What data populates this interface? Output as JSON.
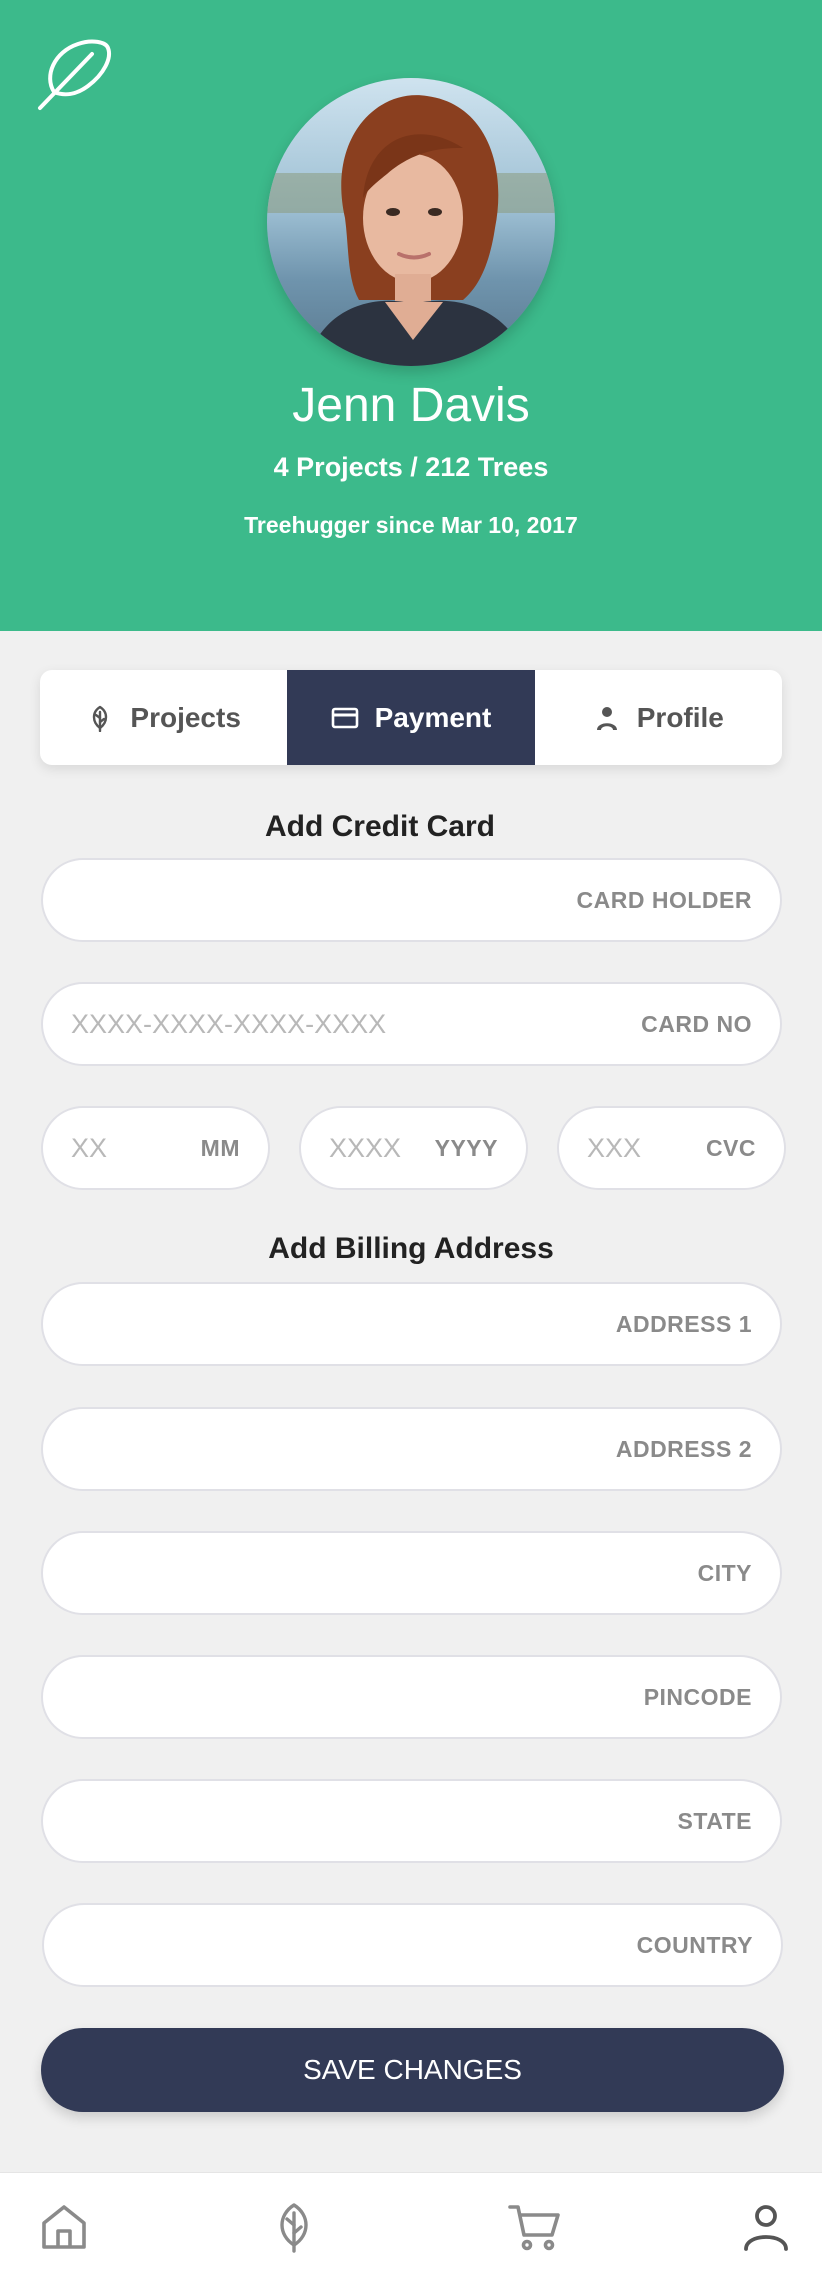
{
  "profile": {
    "name": "Jenn Davis",
    "stats": "4 Projects / 212 Trees",
    "since": "Treehugger since Mar 10, 2017"
  },
  "tabs": [
    {
      "label": "Projects",
      "icon": "leaf-icon"
    },
    {
      "label": "Payment",
      "icon": "credit-card-icon",
      "active": true
    },
    {
      "label": "Profile",
      "icon": "person-icon"
    }
  ],
  "credit_card": {
    "title": "Add Credit Card",
    "card_holder": {
      "label": "CARD HOLDER",
      "placeholder": ""
    },
    "card_no": {
      "label": "CARD NO",
      "placeholder": "XXXX-XXXX-XXXX-XXXX"
    },
    "month": {
      "label": "MM",
      "placeholder": "XX"
    },
    "year": {
      "label": "YYYY",
      "placeholder": "XXXX"
    },
    "cvc": {
      "label": "CVC",
      "placeholder": "XXX"
    }
  },
  "billing": {
    "title": "Add Billing Address",
    "address1": {
      "label": "ADDRESS 1"
    },
    "address2": {
      "label": "ADDRESS 2"
    },
    "city": {
      "label": "CITY"
    },
    "pincode": {
      "label": "PINCODE"
    },
    "state": {
      "label": "STATE"
    },
    "country": {
      "label": "COUNTRY"
    }
  },
  "save_button": "SAVE CHANGES",
  "bottom_nav": [
    "home-icon",
    "leaf-icon",
    "cart-icon",
    "user-icon"
  ],
  "colors": {
    "header_green": "#3cba8b",
    "navy": "#323a56"
  }
}
